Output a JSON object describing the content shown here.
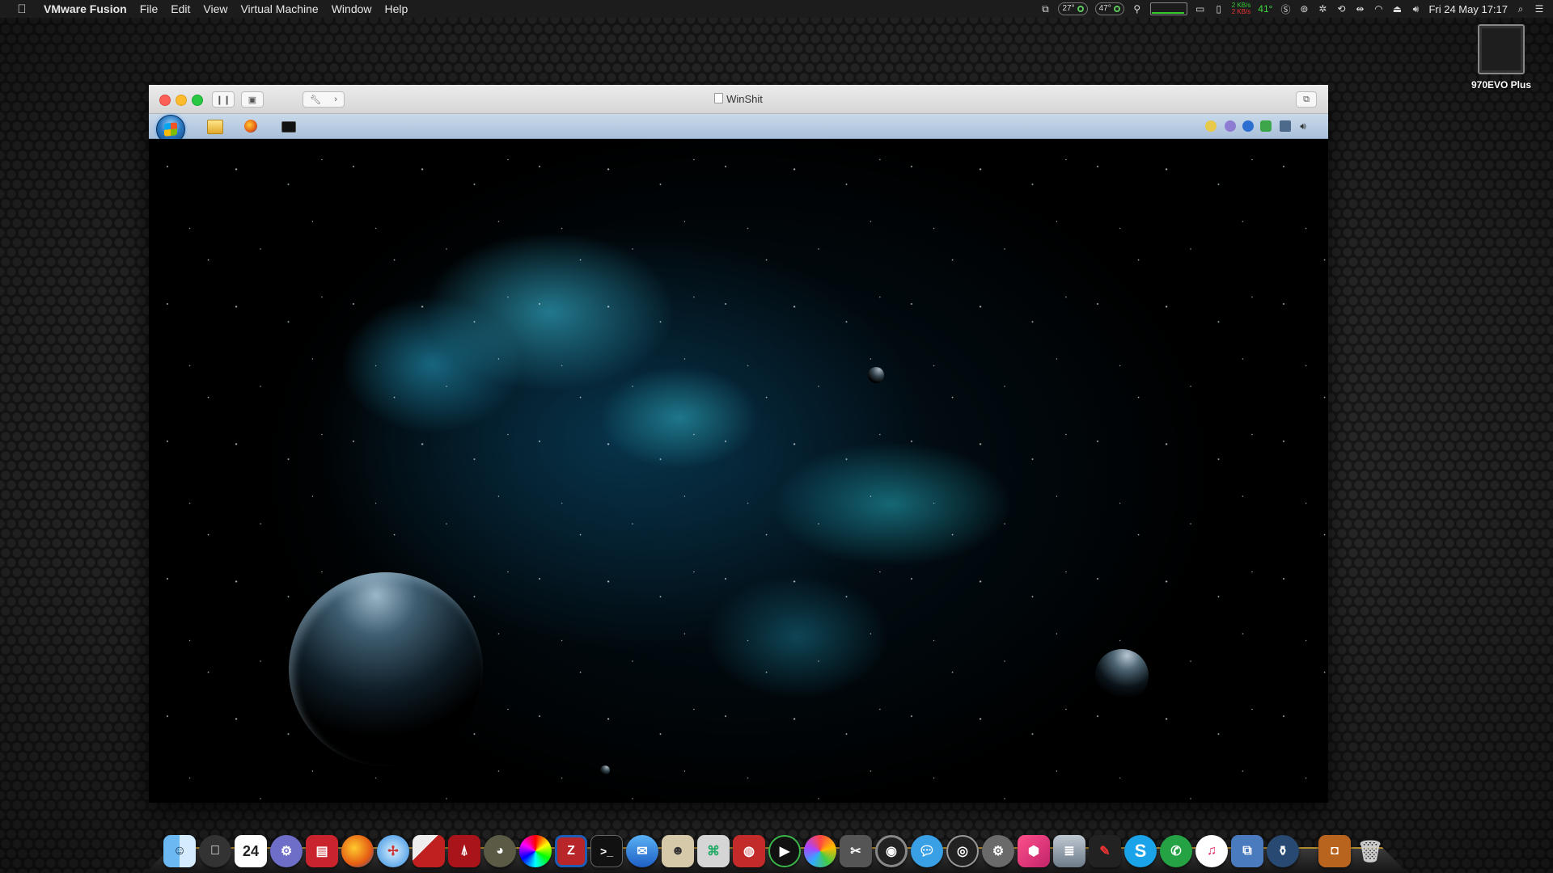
{
  "menubar": {
    "app_name": "VMware Fusion",
    "menus": [
      "File",
      "Edit",
      "View",
      "Virtual Machine",
      "Window",
      "Help"
    ],
    "status": {
      "temp1": "27°",
      "temp2": "47°",
      "net_up": "2 KB/s",
      "net_down": "2 KB/s",
      "cpu_temp": "41°",
      "datetime": "Fri 24 May  17:17"
    }
  },
  "desktop": {
    "drive_label": "970EVO Plus"
  },
  "vm_window": {
    "title": "WinShit"
  },
  "dock": {
    "calendar_day": "24",
    "apps": [
      "finder",
      "apple",
      "calendar",
      "settings-gear",
      "pdf-reader",
      "firefox",
      "safari",
      "adobe-acrobat-red",
      "acrobat",
      "gimp",
      "color-picker",
      "filezilla",
      "terminal",
      "mail",
      "contacts",
      "network-utility",
      "keynote",
      "media-player",
      "photos",
      "video-editor",
      "speaker",
      "messages",
      "camera",
      "system-preferences",
      "creative-app",
      "database",
      "pen-tool",
      "skype",
      "whatsapp",
      "music",
      "virtual-machine",
      "compass",
      "screenshot",
      "trash"
    ]
  },
  "colors": {
    "menubar_bg": "#1c1c1c",
    "dock_trim": "#b08a2e",
    "taskbar_bg": "#bcd0e6"
  }
}
